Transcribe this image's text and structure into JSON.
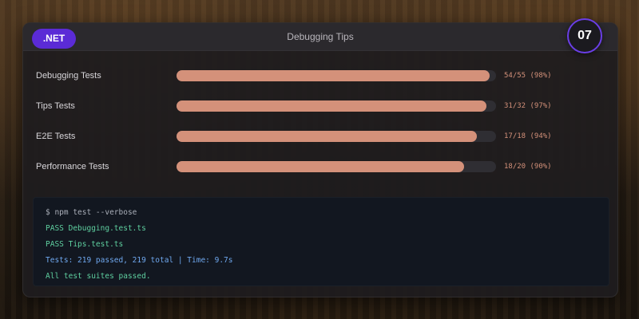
{
  "header": {
    "badge": ".NET",
    "title": "Debugging Tips",
    "number": "07"
  },
  "rows": [
    {
      "label": "Debugging Tests",
      "value": "54/55 (98%)",
      "progress": 0.98
    },
    {
      "label": "Tips Tests",
      "value": "31/32 (97%)",
      "progress": 0.97
    },
    {
      "label": "E2E Tests",
      "value": "17/18 (94%)",
      "progress": 0.94
    },
    {
      "label": "Performance Tests",
      "value": "18/20 (90%)",
      "progress": 0.9
    }
  ],
  "terminal": {
    "lines": [
      {
        "text": "$ npm test --verbose",
        "color": "#a9aeb8"
      },
      {
        "text": "PASS Debugging.test.ts",
        "color": "#5fd0a0"
      },
      {
        "text": "PASS Tips.test.ts",
        "color": "#5fd0a0"
      },
      {
        "text": "Tests: 219 passed, 219 total | Time: 9.7s",
        "color": "#6fa8ef"
      },
      {
        "text": "All test suites passed.",
        "color": "#5fd0a0"
      }
    ]
  },
  "colors": {
    "accent": "#5b2bd6",
    "bar": "#d4917a"
  }
}
